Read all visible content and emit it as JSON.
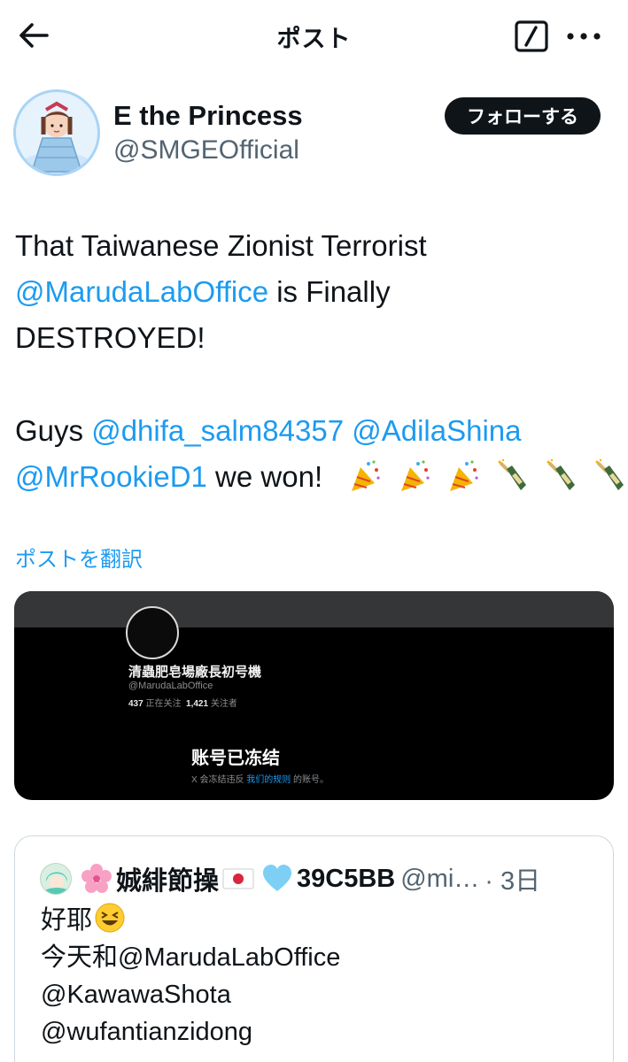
{
  "header": {
    "title": "ポスト",
    "back_icon": "arrow-left-icon",
    "compose_icon": "compose-icon",
    "more_icon": "more-horizontal-icon"
  },
  "author": {
    "name": "E the Princess",
    "handle": "@SMGEOfficial",
    "follow_label": "フォローする"
  },
  "tweet": {
    "lines": [
      [
        "That Taiwanese Zionist Terrorist"
      ],
      [
        "@MarudaLabOffice",
        " is Finally"
      ],
      [
        "DESTROYED!"
      ],
      [
        "Guys ",
        "@dhifa_salm84357",
        " ",
        "@AdilaShina"
      ],
      [
        "@MrRookieD1",
        " we won!"
      ]
    ],
    "emojis": [
      "party-popper-icon",
      "party-popper-icon",
      "party-popper-icon",
      "champagne-icon",
      "champagne-icon",
      "champagne-icon"
    ],
    "translate_label": "ポストを翻訳"
  },
  "media": {
    "account_name": "清蟲肥皂場廠長初号機",
    "account_handle": "@MarudaLabOffice",
    "following_count": "437",
    "following_label": "正在关注",
    "followers_count": "1,421",
    "followers_label": "关注者",
    "frozen_title": "账号已冻结",
    "rule_prefix": "X 会冻结违反",
    "rule_link": "我们的规则",
    "rule_suffix": "的账号。"
  },
  "quote": {
    "name": "娍緋節操",
    "handle_suffix": "39C5BB",
    "handle": "@mi…",
    "time": "· 3日",
    "lines": [
      "好耶",
      "今天和@MarudaLabOffice",
      "@KawawaShota",
      "@wufantianzidong"
    ]
  },
  "colors": {
    "text": "#0f1419",
    "secondary": "#536471",
    "accent": "#1d9bf0",
    "border": "#cfd9de"
  }
}
